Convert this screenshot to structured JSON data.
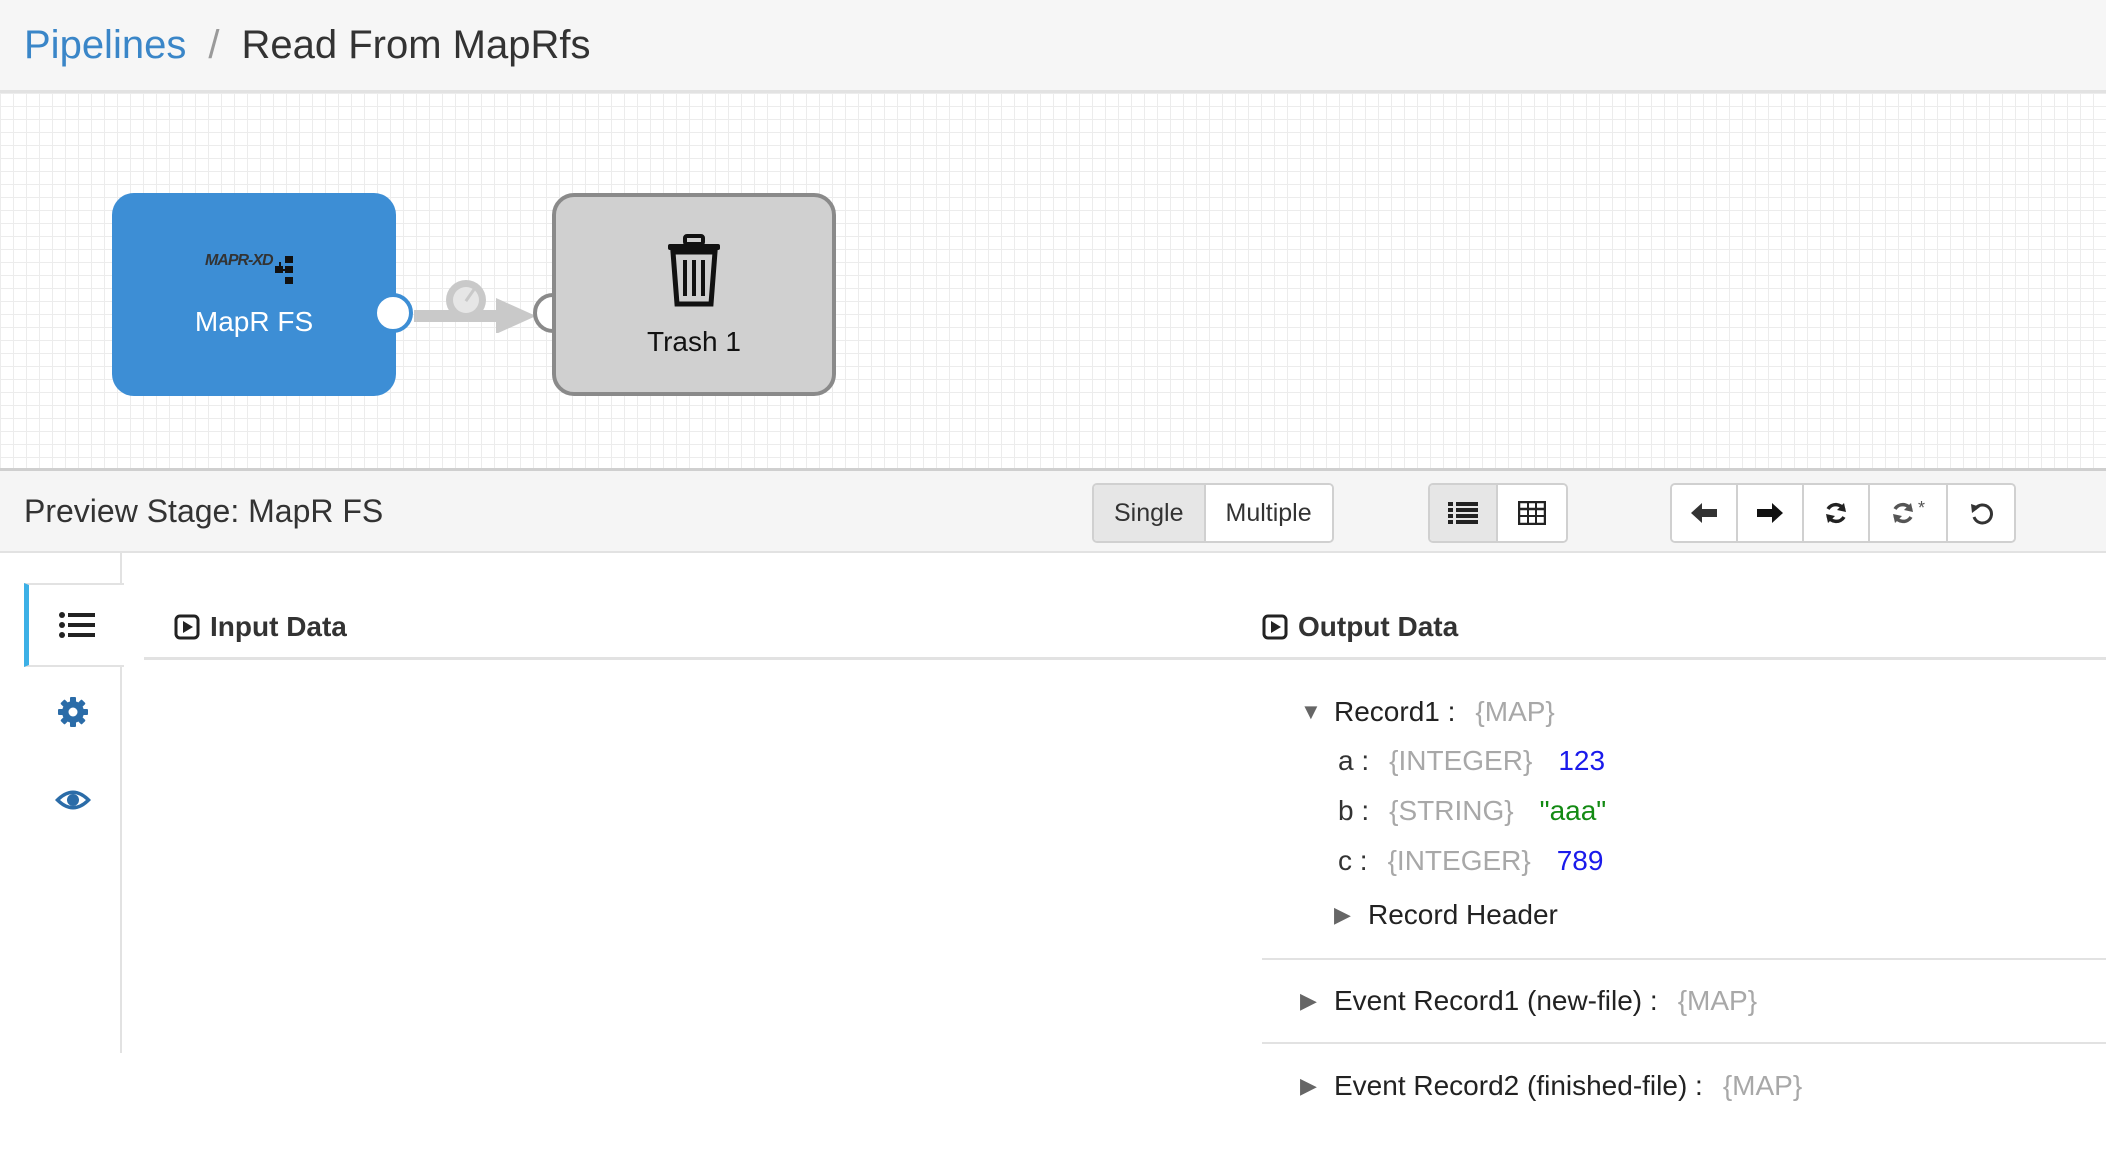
{
  "breadcrumb": {
    "root": "Pipelines",
    "separator": "/",
    "current": "Read From MapRfs"
  },
  "canvas": {
    "source_stage": {
      "label": "MapR FS",
      "logo_text": "MAPR-XD",
      "color": "#3d8ed5"
    },
    "target_stage": {
      "label": "Trash 1",
      "color": "#d0d0d0"
    }
  },
  "preview": {
    "title": "Preview Stage: MapR FS",
    "mode_buttons": [
      "Single",
      "Multiple"
    ],
    "active_mode": "Single",
    "view_icons": [
      "list-view-icon",
      "table-view-icon"
    ],
    "nav_icons": [
      "arrow-left-icon",
      "arrow-right-icon",
      "refresh-icon",
      "refresh-with-changes-icon",
      "reset-icon"
    ],
    "nav_labels": {
      "refresh_changes_marker": "*"
    }
  },
  "rail_icons": [
    "list-icon",
    "gear-icon",
    "eye-icon"
  ],
  "input_section": {
    "title": "Input Data"
  },
  "output_section": {
    "title": "Output Data",
    "records": [
      {
        "name": "Record1 :",
        "type": "{MAP}",
        "expanded": true,
        "fields": [
          {
            "key": "a :",
            "type": "{INTEGER}",
            "value": "123",
            "kind": "int"
          },
          {
            "key": "b :",
            "type": "{STRING}",
            "value": "\"aaa\"",
            "kind": "str"
          },
          {
            "key": "c :",
            "type": "{INTEGER}",
            "value": "789",
            "kind": "int"
          }
        ],
        "header_label": "Record Header"
      },
      {
        "name": "Event Record1 (new-file) :",
        "type": "{MAP}",
        "expanded": false
      },
      {
        "name": "Event Record2 (finished-file) :",
        "type": "{MAP}",
        "expanded": false
      }
    ]
  }
}
